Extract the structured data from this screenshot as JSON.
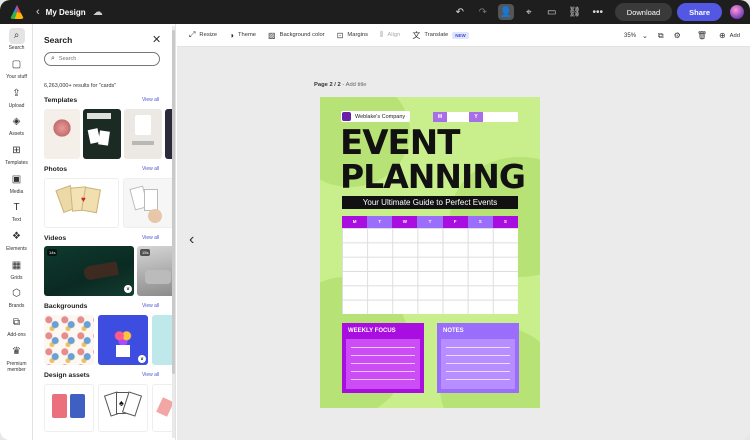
{
  "titlebar": {
    "doc_title": "My Design",
    "download_label": "Download",
    "share_label": "Share"
  },
  "rail": {
    "items": [
      {
        "label": "Search",
        "icon": "search-icon",
        "active": true
      },
      {
        "label": "Your stuff",
        "icon": "folder-icon"
      },
      {
        "label": "Upload",
        "icon": "upload-icon"
      },
      {
        "label": "Assets",
        "icon": "assets-icon"
      },
      {
        "label": "Templates",
        "icon": "templates-icon"
      },
      {
        "label": "Media",
        "icon": "media-icon"
      },
      {
        "label": "Text",
        "icon": "text-icon"
      },
      {
        "label": "Elements",
        "icon": "elements-icon"
      },
      {
        "label": "Grids",
        "icon": "grids-icon"
      },
      {
        "label": "Brands",
        "icon": "brands-icon"
      },
      {
        "label": "Add-ons",
        "icon": "addons-icon"
      },
      {
        "label": "Premium member",
        "icon": "crown-icon"
      }
    ]
  },
  "panel": {
    "title": "Search",
    "search_placeholder": "Search",
    "results_text": "6,263,000+ results for \"cards\"",
    "view_all": "View all",
    "sections": [
      {
        "title": "Templates"
      },
      {
        "title": "Photos"
      },
      {
        "title": "Videos"
      },
      {
        "title": "Backgrounds"
      },
      {
        "title": "Design assets"
      }
    ],
    "video_badges": [
      "14s",
      "15s"
    ]
  },
  "toolbar": {
    "resize": "Resize",
    "theme": "Theme",
    "background_color": "Background color",
    "margins": "Margins",
    "align": "Align",
    "translate": "Translate",
    "translate_badge": "NEW",
    "zoom": "35%",
    "add": "Add"
  },
  "canvas": {
    "page_label": "Page 2 / 2",
    "add_title": " - Add title"
  },
  "poster": {
    "company": "Weblake's Company",
    "month_letters": [
      "M",
      "Y"
    ],
    "headline_1": "EVENT",
    "headline_2": "PLANNING",
    "subtitle": "Your Ultimate Guide to Perfect Events",
    "days": [
      "M",
      "T",
      "W",
      "T",
      "F",
      "S",
      "S"
    ],
    "weekly_focus": "WEEKLY FOCUS",
    "notes": "NOTES",
    "colors": {
      "background": "#c9ef8c",
      "purple": "#a90ee0",
      "lavender": "#9a6dfa"
    }
  }
}
